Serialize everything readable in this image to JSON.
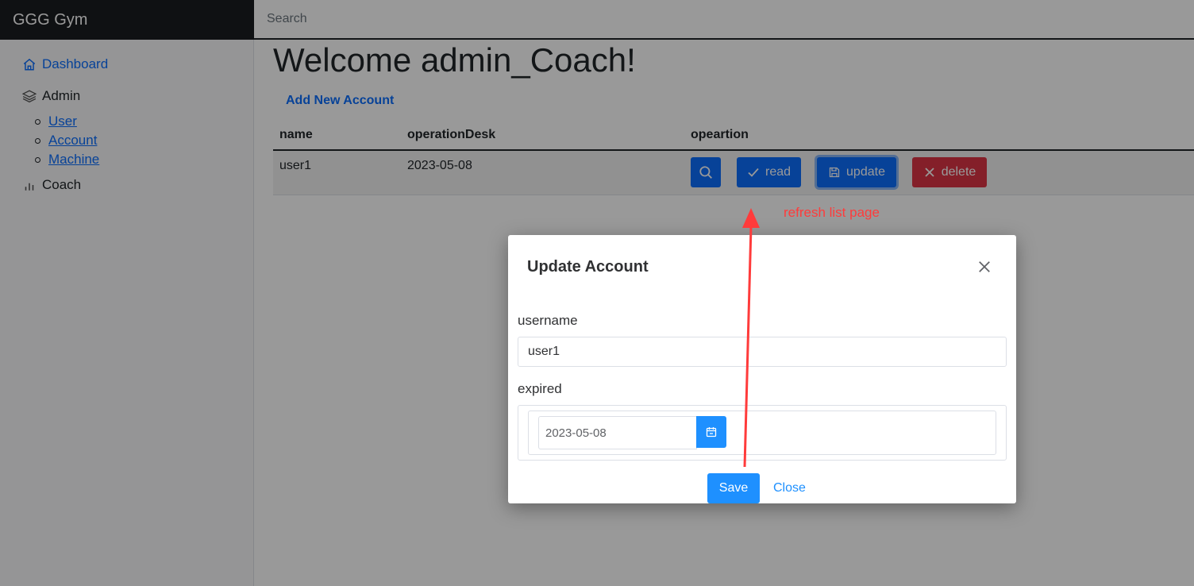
{
  "app": {
    "brand": "GGG Gym"
  },
  "search": {
    "placeholder": "Search",
    "value": ""
  },
  "sidebar": {
    "dashboard": "Dashboard",
    "admin": "Admin",
    "admin_items": [
      "User",
      "Account",
      "Machine"
    ],
    "coach": "Coach"
  },
  "main": {
    "title": "Welcome admin_Coach!",
    "add_link": "Add New Account",
    "table": {
      "headers": [
        "name",
        "operationDesk",
        "opeartion"
      ],
      "rows": [
        {
          "name": "user1",
          "operationDesk": "2023-05-08"
        }
      ]
    },
    "buttons": {
      "read": "read",
      "update": "update",
      "delete": "delete"
    }
  },
  "annotation": {
    "text": "refresh list page",
    "color": "#ff3b3b"
  },
  "modal": {
    "title": "Update Account",
    "username_label": "username",
    "username_value": "user1",
    "expired_label": "expired",
    "expired_value": "2023-05-08",
    "save_label": "Save",
    "close_label": "Close"
  },
  "colors": {
    "primary": "#0d6efd",
    "danger": "#dc3545",
    "element_blue": "#1e90ff",
    "topbar": "#212529"
  },
  "icons": {
    "dashboard": "home-icon",
    "admin": "layers-icon",
    "coach": "bar-chart-icon",
    "search_btn": "search-icon",
    "read": "check-icon",
    "update": "save-icon",
    "delete": "close-icon",
    "calendar": "calendar-icon",
    "modal_close": "close-icon"
  }
}
